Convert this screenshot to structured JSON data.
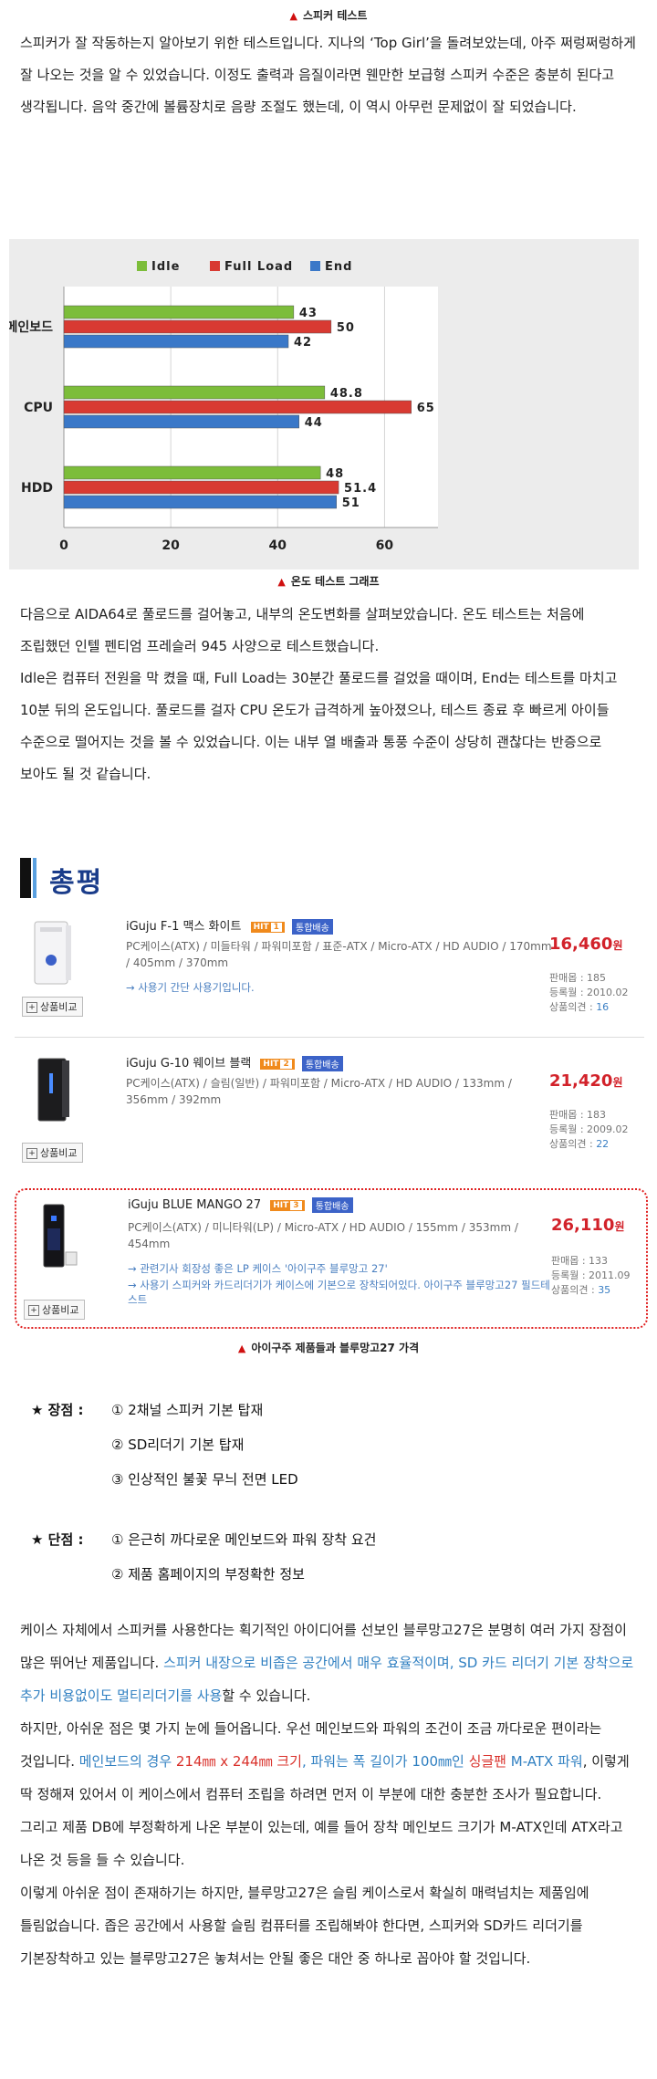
{
  "top_caption": "스피커 테스트",
  "top_paragraph": "스피커가 잘 작동하는지 알아보기 위한 테스트입니다. 지나의 ‘Top Girl’을 돌려보았는데, 아주 쩌렁쩌렁하게 잘 나오는 것을 알 수 있었습니다. 이정도 출력과 음질이라면 웬만한 보급형 스피커 수준은 충분히 된다고 생각됩니다. 음악 중간에 볼륨장치로 음량 조절도 했는데, 이 역시 아무런 문제없이 잘 되었습니다.",
  "chart_caption": "온도 테스트 그래프",
  "chart_data": {
    "type": "bar",
    "orientation": "horizontal",
    "categories": [
      "메인보드",
      "CPU",
      "HDD"
    ],
    "series": [
      {
        "name": "Idle",
        "values": [
          43,
          48.8,
          48
        ],
        "labels": [
          "43",
          "48.8",
          "48"
        ],
        "color": "#7cbd3a"
      },
      {
        "name": "Full Load",
        "values": [
          50,
          65,
          51.4
        ],
        "labels": [
          "50",
          "65",
          "51.4"
        ],
        "color": "#d83a32"
      },
      {
        "name": "End",
        "values": [
          42,
          44,
          51
        ],
        "labels": [
          "42",
          "44",
          "51"
        ],
        "color": "#3a78c8"
      }
    ],
    "xlim": [
      0,
      70
    ],
    "xticks": [
      0,
      20,
      40,
      60
    ],
    "grid": true,
    "legend_position": "top"
  },
  "mid_paragraphs": [
    "다음으로 AIDA64로 풀로드를 걸어놓고, 내부의 온도변화를 살펴보았습니다. 온도 테스트는 처음에 조립했던 인텔 펜티엄 프레슬러 945 사양으로 테스트했습니다.",
    "Idle은 컴퓨터 전원을 막 켰을 때, Full Load는 30분간 풀로드를 걸었을 때이며, End는 테스트를 마치고 10분 뒤의 온도입니다. 풀로드를 걸자 CPU 온도가 급격하게 높아졌으나, 테스트 종료 후 빠르게 아이들 수준으로 떨어지는 것을 볼 수 있었습니다. 이는 내부 열 배출과 통풍 수준이 상당히 괜찮다는 반증으로 보아도 될 것 같습니다."
  ],
  "review_title": "총평",
  "products": [
    {
      "name": "iGuju F-1 맥스 화이트",
      "hit_label": "HIT",
      "hit_rank": "1",
      "delivery_badge": "통합배송",
      "spec": "PC케이스(ATX) / 미들타워 / 파워미포함 / 표준-ATX / Micro-ATX / HD AUDIO / 170mm / 405mm / 370mm",
      "price": "16,460",
      "price_unit": "원",
      "sales_label": "판매몹 : 185",
      "reg_label": "등록월 : 2010.02",
      "opinion_label": "상품의견 : ",
      "opinion_count": "16",
      "link": "→ 사용기 간단 사용기입니다.",
      "compare_label": "상품비교"
    },
    {
      "name": "iGuju G-10 웨이브 블랙",
      "hit_label": "HIT",
      "hit_rank": "2",
      "delivery_badge": "통합배송",
      "spec": "PC케이스(ATX) / 슬림(일반) / 파워미포함 / Micro-ATX / HD AUDIO / 133mm / 356mm / 392mm",
      "price": "21,420",
      "price_unit": "원",
      "sales_label": "판매몹 : 183",
      "reg_label": "등록월 : 2009.02",
      "opinion_label": "상품의견 : ",
      "opinion_count": "22",
      "link": "",
      "compare_label": "상품비교"
    },
    {
      "name": "iGuju BLUE MANGO 27",
      "hit_label": "HIT",
      "hit_rank": "3",
      "delivery_badge": "통합배송",
      "spec": "PC케이스(ATX) / 미니타워(LP) / Micro-ATX / HD AUDIO / 155mm / 353mm / 454mm",
      "price": "26,110",
      "price_unit": "원",
      "sales_label": "판매몹 : 133",
      "reg_label": "등록월 : 2011.09",
      "opinion_label": "상품의견 : ",
      "opinion_count": "35",
      "link": "→ 관련기사 회장성 좋은 LP 케이스 '아이구주 블루망고 27'",
      "link2": "→ 사용기 스피커와 카드리더기가 케이스에 기본으로 장착되어있다. 아이구주 블루망고27 필드테스트",
      "compare_label": "상품비교"
    }
  ],
  "products_caption": "아이구주 제품들과 블루망고27 가격",
  "pros_label": "★ 장점 :",
  "pros": [
    "① 2채널 스피커 기본 탑재",
    "② SD리더기 기본 탑재",
    "③ 인상적인 불꽃 무늬 전면 LED"
  ],
  "cons_label": "★ 단점 :",
  "cons": [
    "① 은근히 까다로운 메인보드와 파워 장착 요건",
    "② 제품 홈페이지의 부정확한 정보"
  ],
  "bottom": {
    "p1_a": "케이스 자체에서 스피커를 사용한다는 획기적인 아이디어를 선보인 블루망고27은 분명히 여러 가지 장점이 많은 뛰어난 제품입니다. ",
    "p1_b": "스피커 내장으로 비좁은 공간에서 매우 효율적이며, SD 카드 리더기 기본 장착으로 추가 비용없이도 멀티리더기를 사용",
    "p1_c": "할 수 있습니다.",
    "p2_a": "하지만, 아쉬운 점은 몇 가지 눈에 들어옵니다. 우선 메인보드와 파워의 조건이 조금 까다로운 편이라는 것입니다. ",
    "p2_b": "메인보드의 경우 ",
    "p2_c": "214㎜ x 244㎜ 크기",
    "p2_d": ", 파워는 폭 길이가 100㎜인 ",
    "p2_e": "싱글팬",
    "p2_f": " M-ATX 파워",
    "p2_g": ", 이렇게 딱 정해져 있어서 이 케이스에서 컴퓨터 조립을 하려면 먼저 이 부분에 대한 충분한 조사가 필요합니다. 그리고 제품 DB에 부정확하게 나온 부분이 있는데, 예를 들어 장착 메인보드 크기가 M-ATX인데 ATX라고 나온 것 등을 들 수 있습니다.",
    "p3": "이렇게 아쉬운 점이 존재하기는 하지만, 블루망고27은 슬림 케이스로서 확실히 매력넘치는 제품임에 틀림없습니다. 좁은 공간에서 사용할 슬림 컴퓨터를 조립해봐야 한다면, 스피커와 SD카드 리더기를 기본장착하고 있는 블루망고27은 놓쳐서는 안될 좋은 대안 중 하나로 꼽아야 할 것입니다."
  }
}
